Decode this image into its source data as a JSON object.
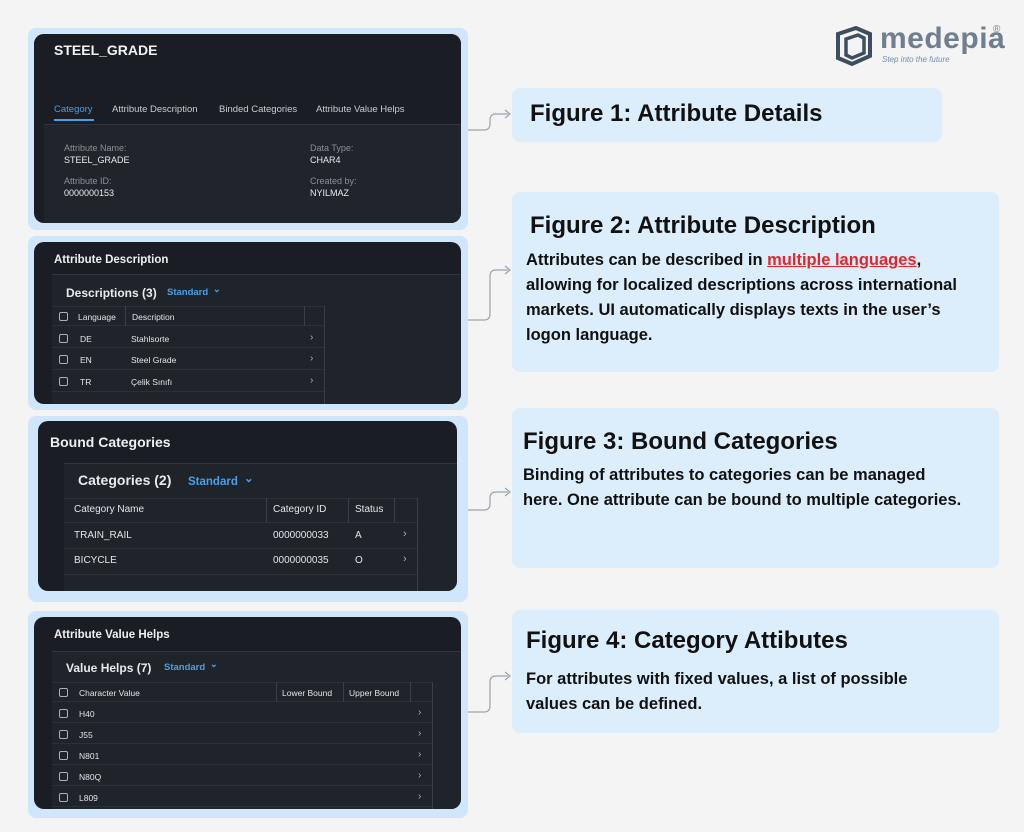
{
  "logo": {
    "name": "medepia",
    "tagline": "Step into the future",
    "mark": "®"
  },
  "figure1": {
    "panel_title": "STEEL_GRADE",
    "tabs": [
      "Category",
      "Attribute Description",
      "Binded Categories",
      "Attribute Value Helps"
    ],
    "active_tab": 0,
    "fields": {
      "attribute_name_label": "Attribute Name:",
      "attribute_name_value": "STEEL_GRADE",
      "attribute_id_label": "Attribute ID:",
      "attribute_id_value": "0000000153",
      "data_type_label": "Data Type:",
      "data_type_value": "CHAR4",
      "created_by_label": "Created by:",
      "created_by_value": "NYILMAZ"
    },
    "callout_title": "Figure 1: Attribute Details"
  },
  "figure2": {
    "section_title": "Attribute Description",
    "table_title": "Descriptions (3)",
    "variant": "Standard",
    "columns": [
      "Language",
      "Description"
    ],
    "rows": [
      {
        "language": "DE",
        "description": "Stahlsorte"
      },
      {
        "language": "EN",
        "description": "Steel Grade"
      },
      {
        "language": "TR",
        "description": "Çelik Sınıfı"
      }
    ],
    "callout_title": "Figure 2: Attribute Description",
    "callout_text_before": "Attributes can be described in ",
    "callout_highlight": "multiple languages",
    "callout_text_after": ", allowing for localized descriptions across international markets. UI automatically displays texts in the user’s logon language."
  },
  "figure3": {
    "section_title": "Bound Categories",
    "table_title": "Categories (2)",
    "variant": "Standard",
    "columns": [
      "Category Name",
      "Category ID",
      "Status"
    ],
    "rows": [
      {
        "name": "TRAIN_RAIL",
        "id": "0000000033",
        "status": "A"
      },
      {
        "name": "BICYCLE",
        "id": "0000000035",
        "status": "O"
      }
    ],
    "callout_title": "Figure 3: Bound Categories",
    "callout_text": "Binding of attributes to categories can be managed here. One attribute can be bound to multiple categories."
  },
  "figure4": {
    "section_title": "Attribute Value Helps",
    "table_title": "Value Helps (7)",
    "variant": "Standard",
    "columns": [
      "Character Value",
      "Lower Bound",
      "Upper Bound"
    ],
    "rows": [
      {
        "value": "H40"
      },
      {
        "value": "J55"
      },
      {
        "value": "N801"
      },
      {
        "value": "N80Q"
      },
      {
        "value": "L809"
      }
    ],
    "callout_title": "Figure 4: Category Attibutes",
    "callout_text": "For attributes with fixed values, a list of possible values can be defined."
  },
  "icons": {
    "chevron_right": "›",
    "chevron_down": "⌄"
  }
}
